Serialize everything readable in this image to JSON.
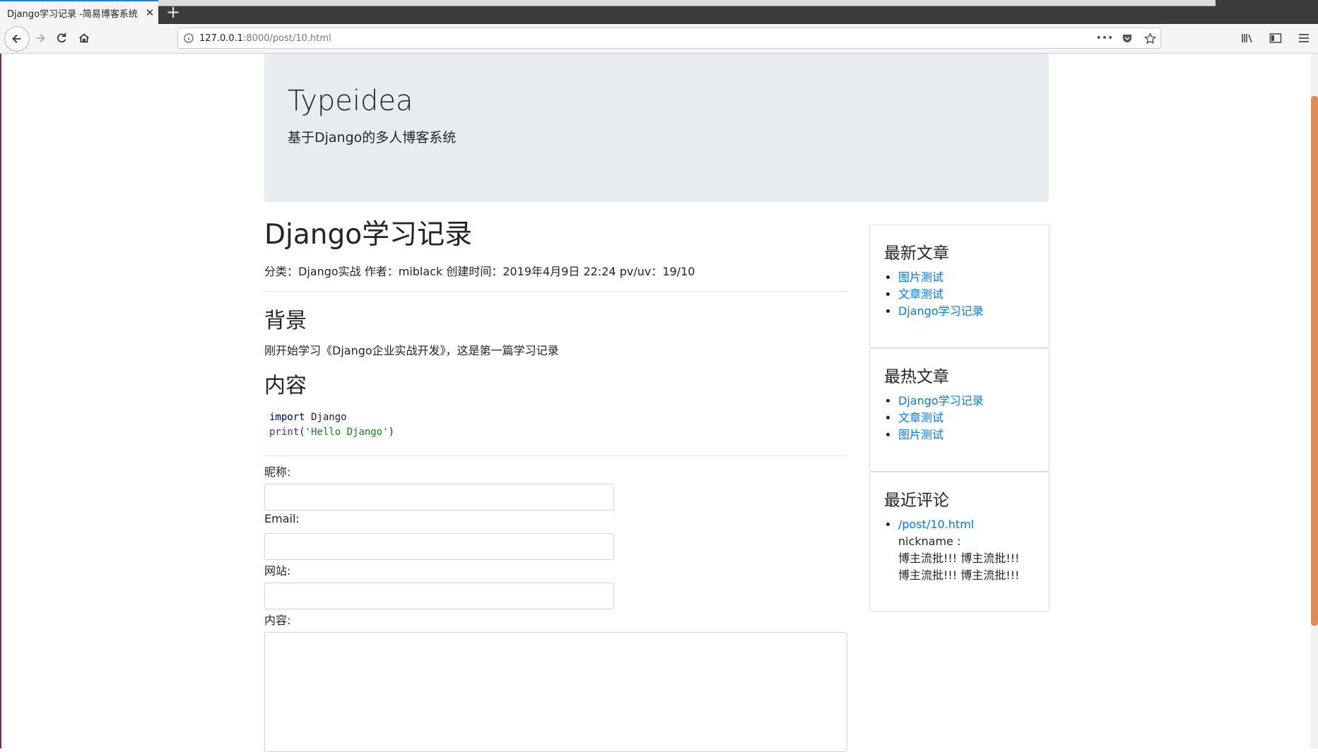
{
  "browser": {
    "tab_title": "Django学习记录 -简易博客系统",
    "tab_close": "✕",
    "new_tab": "+",
    "url_host": "127.0.0.1",
    "url_path": ":8000/post/10.html",
    "url_more": "•••"
  },
  "header": {
    "site_title": "Typeidea",
    "site_subtitle": "基于Django的多人博客系统"
  },
  "post": {
    "title": "Django学习记录",
    "meta": "分类：Django实战 作者：miblack 创建时间：2019年4月9日 22:24 pv/uv：19/10",
    "section1_heading": "背景",
    "section1_text": "刚开始学习《Django企业实战开发》，这是第一篇学习记录",
    "section2_heading": "内容",
    "code": {
      "line1_kw": "import",
      "line1_rest": " Django",
      "line2_fn": "print",
      "line2_open": "(",
      "line2_str": "'Hello Django'",
      "line2_close": ")"
    }
  },
  "form": {
    "nickname_label": "昵称:",
    "email_label": "Email:",
    "website_label": "网站:",
    "content_label": "内容:"
  },
  "sidebar": {
    "latest": {
      "title": "最新文章",
      "items": [
        "图片测试",
        "文章测试",
        "Django学习记录"
      ]
    },
    "hottest": {
      "title": "最热文章",
      "items": [
        "Django学习记录",
        "文章测试",
        "图片测试"
      ]
    },
    "comments": {
      "title": "最近评论",
      "link": "/post/10.html",
      "nickname": "nickname :",
      "line1": "博主流批!!! 博主流批!!!",
      "line2": "博主流批!!! 博主流批!!!"
    }
  }
}
